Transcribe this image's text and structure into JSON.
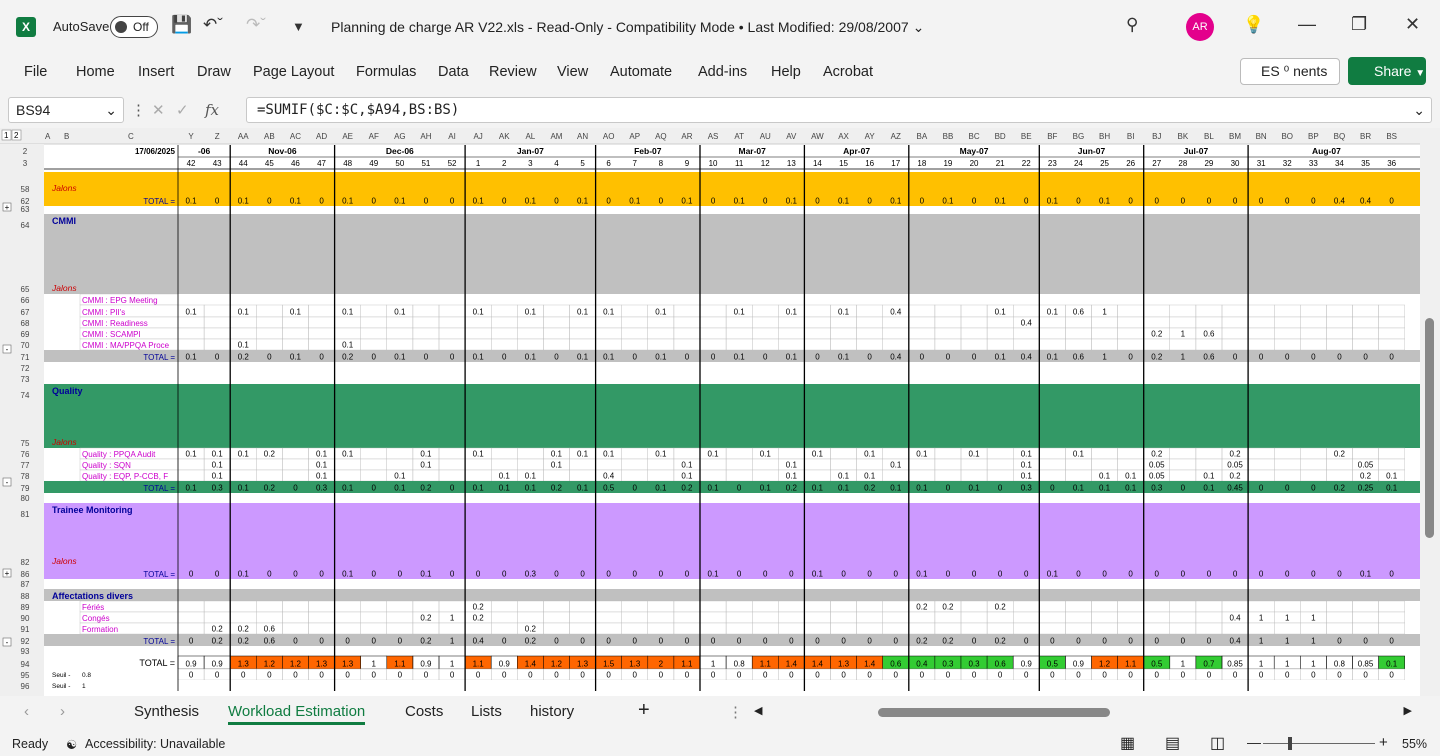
{
  "app": {
    "autosave_label": "AutoSave",
    "autosave_state": "Off",
    "logo": "X"
  },
  "window": {
    "title": "Planning de charge AR V22.xls  -  Read-Only  -  Compatibility Mode  •  Last Modified: 29/08/2007",
    "user_initials": "AR"
  },
  "menu": [
    "File",
    "Home",
    "Insert",
    "Draw",
    "Page Layout",
    "Formulas",
    "Data",
    "Review",
    "View",
    "Automate",
    "Add-ins",
    "Help",
    "Acrobat"
  ],
  "ribbon": {
    "comments_label": "ES  ⁰ nents",
    "share_label": "Share"
  },
  "formula_bar": {
    "name_box": "BS94",
    "formula": "=SUMIF($C:$C,$A94,BS:BS)"
  },
  "sheet": {
    "date_cell": "17/06/2025",
    "columns": [
      "Y",
      "Z",
      "AA",
      "AB",
      "AC",
      "AD",
      "AE",
      "AF",
      "AG",
      "AH",
      "AI",
      "AJ",
      "AK",
      "AL",
      "AM",
      "AN",
      "AO",
      "AP",
      "AQ",
      "AR",
      "AS",
      "AT",
      "AU",
      "AV",
      "AW",
      "AX",
      "AY",
      "AZ",
      "BA",
      "BB",
      "BC",
      "BD",
      "BE",
      "BF",
      "BG",
      "BH",
      "BI",
      "BJ",
      "BK",
      "BL",
      "BM",
      "BN",
      "BO",
      "BP",
      "BQ",
      "BR",
      "BS"
    ],
    "weeks": [
      "42",
      "43",
      "44",
      "45",
      "46",
      "47",
      "48",
      "49",
      "50",
      "51",
      "52",
      "1",
      "2",
      "3",
      "4",
      "5",
      "6",
      "7",
      "8",
      "9",
      "10",
      "11",
      "12",
      "13",
      "14",
      "15",
      "16",
      "17",
      "18",
      "19",
      "20",
      "21",
      "22",
      "23",
      "24",
      "25",
      "26",
      "27",
      "28",
      "29",
      "30",
      "31",
      "32",
      "33",
      "34",
      "35",
      "36"
    ],
    "months": [
      {
        "label": "-06",
        "start": 0,
        "span": 2
      },
      {
        "label": "Nov-06",
        "start": 2,
        "span": 4
      },
      {
        "label": "Dec-06",
        "start": 6,
        "span": 5
      },
      {
        "label": "Jan-07",
        "start": 11,
        "span": 5
      },
      {
        "label": "Feb-07",
        "start": 16,
        "span": 4
      },
      {
        "label": "Mar-07",
        "start": 20,
        "span": 4
      },
      {
        "label": "Apr-07",
        "start": 24,
        "span": 4
      },
      {
        "label": "May-07",
        "start": 28,
        "span": 5
      },
      {
        "label": "Jun-07",
        "start": 33,
        "span": 4
      },
      {
        "label": "Jul-07",
        "start": 37,
        "span": 4
      },
      {
        "label": "Aug-07",
        "start": 41,
        "span": 6
      }
    ],
    "rows": [
      {
        "num": "58",
        "h": 22,
        "bg": "#ffc000",
        "label": "Jalons",
        "label_style": "jalon"
      },
      {
        "num": "62",
        "h": 12,
        "bg": "#ffc000",
        "label": "TOTAL =",
        "label_style": "total",
        "vals": [
          "0.1",
          "0",
          "0.1",
          "0",
          "0.1",
          "0",
          "0.1",
          "0",
          "0.1",
          "0",
          "0",
          "0.1",
          "0",
          "0.1",
          "0",
          "0.1",
          "0",
          "0.1",
          "0",
          "0.1",
          "0",
          "0.1",
          "0",
          "0.1",
          "0",
          "0.1",
          "0",
          "0.1",
          "0",
          "0.1",
          "0",
          "0.1",
          "0",
          "0.1",
          "0",
          "0.1",
          "0",
          "0",
          "0",
          "0",
          "0",
          "0",
          "0",
          "0",
          "0.4",
          "0.4",
          "0"
        ]
      },
      {
        "num": "63",
        "h": 8,
        "bg": "#ffffff"
      },
      {
        "num": "64",
        "h": 16,
        "bg": "#c0c0c0",
        "section": "CMMI"
      },
      {
        "num": "65",
        "h": 64,
        "bg": "#c0c0c0",
        "label": "Jalons",
        "label_style": "jalon"
      },
      {
        "num": "66",
        "h": 11,
        "bg": "#ffffff",
        "sub": "CMMI : EPG Meeting",
        "vals": []
      },
      {
        "num": "67",
        "h": 12,
        "bg": "#ffffff",
        "sub": "CMMI : PII's",
        "vals": [
          "0.1",
          "",
          "0.1",
          "",
          "0.1",
          "",
          "0.1",
          "",
          "0.1",
          "",
          "",
          "0.1",
          "",
          "0.1",
          "",
          "0.1",
          "0.1",
          "",
          "0.1",
          "",
          "",
          "0.1",
          "",
          "0.1",
          "",
          "0.1",
          "",
          "0.4",
          "",
          "",
          "",
          "0.1",
          "",
          "0.1",
          "0.6",
          "1",
          "",
          "",
          "",
          "",
          "",
          "",
          "",
          "",
          "",
          "",
          ""
        ]
      },
      {
        "num": "68",
        "h": 11,
        "bg": "#ffffff",
        "sub": "CMMI : Readiness",
        "vals": [
          "",
          "",
          "",
          "",
          "",
          "",
          "",
          "",
          "",
          "",
          "",
          "",
          "",
          "",
          "",
          "",
          "",
          "",
          "",
          "",
          "",
          "",
          "",
          "",
          "",
          "",
          "",
          "",
          "",
          "",
          "",
          "",
          "0.4",
          "",
          "",
          "",
          "",
          "",
          "",
          "",
          "",
          "",
          "",
          "",
          "",
          "",
          ""
        ]
      },
      {
        "num": "69",
        "h": 11,
        "bg": "#ffffff",
        "sub": "CMMI : SCAMPI",
        "vals": [
          "",
          "",
          "",
          "",
          "",
          "",
          "",
          "",
          "",
          "",
          "",
          "",
          "",
          "",
          "",
          "",
          "",
          "",
          "",
          "",
          "",
          "",
          "",
          "",
          "",
          "",
          "",
          "",
          "",
          "",
          "",
          "",
          "",
          "",
          "",
          "",
          "",
          "0.2",
          "1",
          "0.6",
          "",
          "",
          "",
          "",
          "",
          "",
          ""
        ]
      },
      {
        "num": "70",
        "h": 11,
        "bg": "#ffffff",
        "sub": "CMMI : MA/PPQA Proce",
        "vals": [
          "",
          "",
          "0.1",
          "",
          "",
          "",
          "0.1",
          "",
          "",
          "",
          "",
          "",
          "",
          "",
          "",
          "",
          "",
          "",
          "",
          "",
          "",
          "",
          "",
          "",
          "",
          "",
          "",
          "",
          "",
          "",
          "",
          "",
          "",
          "",
          "",
          "",
          "",
          "",
          "",
          "",
          "",
          "",
          "",
          "",
          "",
          "",
          ""
        ]
      },
      {
        "num": "71",
        "h": 12,
        "bg": "#c0c0c0",
        "label": "TOTAL =",
        "label_style": "total",
        "vals": [
          "0.1",
          "0",
          "0.2",
          "0",
          "0.1",
          "0",
          "0.2",
          "0",
          "0.1",
          "0",
          "0",
          "0.1",
          "0",
          "0.1",
          "0",
          "0.1",
          "0.1",
          "0",
          "0.1",
          "0",
          "0",
          "0.1",
          "0",
          "0.1",
          "0",
          "0.1",
          "0",
          "0.4",
          "0",
          "0",
          "0",
          "0.1",
          "0.4",
          "0.1",
          "0.6",
          "1",
          "0",
          "0.2",
          "1",
          "0.6",
          "0",
          "0",
          "0",
          "0",
          "0",
          "0",
          "0"
        ]
      },
      {
        "num": "72",
        "h": 11,
        "bg": "#ffffff"
      },
      {
        "num": "73",
        "h": 11,
        "bg": "#ffffff"
      },
      {
        "num": "74",
        "h": 16,
        "bg": "#339966",
        "section": "Quality"
      },
      {
        "num": "75",
        "h": 48,
        "bg": "#339966",
        "label": "Jalons",
        "label_style": "jalon"
      },
      {
        "num": "76",
        "h": 11,
        "bg": "#ffffff",
        "sub": "Quality : PPQA Audit",
        "vals": [
          "0.1",
          "0.1",
          "0.1",
          "0.2",
          "",
          "0.1",
          "0.1",
          "",
          "",
          "0.1",
          "",
          "0.1",
          "",
          "",
          "0.1",
          "0.1",
          "0.1",
          "",
          "0.1",
          "",
          "0.1",
          "",
          "0.1",
          "",
          "0.1",
          "",
          "0.1",
          "",
          "0.1",
          "",
          "0.1",
          "",
          "0.1",
          "",
          "0.1",
          "",
          "",
          "0.2",
          "",
          "",
          "0.2",
          "",
          "",
          "",
          "0.2",
          "",
          ""
        ]
      },
      {
        "num": "77",
        "h": 11,
        "bg": "#ffffff",
        "sub": "Quality : SQN",
        "vals": [
          "",
          "0.1",
          "",
          "",
          "",
          "0.1",
          "",
          "",
          "",
          "0.1",
          "",
          "",
          "",
          "",
          "0.1",
          "",
          "",
          "",
          "",
          "0.1",
          "",
          "",
          "",
          "0.1",
          "",
          "",
          "",
          "0.1",
          "",
          "",
          "",
          "",
          "0.1",
          "",
          "",
          "",
          "",
          "0.05",
          "",
          "",
          "0.05",
          "",
          "",
          "",
          "",
          "0.05",
          ""
        ]
      },
      {
        "num": "78",
        "h": 11,
        "bg": "#ffffff",
        "sub": "Quality : EQP, P-CCB, F",
        "vals": [
          "",
          "0.1",
          "",
          "",
          "",
          "0.1",
          "",
          "",
          "0.1",
          "",
          "",
          "",
          "0.1",
          "0.1",
          "",
          "",
          "0.4",
          "",
          "",
          "0.1",
          "",
          "",
          "",
          "0.1",
          "",
          "0.1",
          "0.1",
          "",
          "",
          "",
          "",
          "",
          "0.1",
          "",
          "",
          "0.1",
          "0.1",
          "0.05",
          "",
          "0.1",
          "0.2",
          "",
          "",
          "",
          "",
          "0.2",
          "0.1"
        ]
      },
      {
        "num": "79",
        "h": 12,
        "bg": "#339966",
        "label": "TOTAL =",
        "label_style": "total",
        "vals": [
          "0.1",
          "0.3",
          "0.1",
          "0.2",
          "0",
          "0.3",
          "0.1",
          "0",
          "0.1",
          "0.2",
          "0",
          "0.1",
          "0.1",
          "0.1",
          "0.2",
          "0.1",
          "0.5",
          "0",
          "0.1",
          "0.2",
          "0.1",
          "0",
          "0.1",
          "0.2",
          "0.1",
          "0.1",
          "0.2",
          "0.1",
          "0.1",
          "0",
          "0.1",
          "0",
          "0.3",
          "0",
          "0.1",
          "0.1",
          "0.1",
          "0.3",
          "0",
          "0.1",
          "0.45",
          "0",
          "0",
          "0",
          "0.2",
          "0.25",
          "0.1"
        ]
      },
      {
        "num": "80",
        "h": 10,
        "bg": "#ffffff"
      },
      {
        "num": "81",
        "h": 16,
        "bg": "#cc99ff",
        "section": "Trainee Monitoring"
      },
      {
        "num": "82",
        "h": 48,
        "bg": "#cc99ff",
        "label": "Jalons",
        "label_style": "jalon"
      },
      {
        "num": "86",
        "h": 12,
        "bg": "#cc99ff",
        "label": "TOTAL =",
        "label_style": "total",
        "vals": [
          "0",
          "0",
          "0.1",
          "0",
          "0",
          "0",
          "0.1",
          "0",
          "0",
          "0.1",
          "0",
          "0",
          "0",
          "0.3",
          "0",
          "0",
          "0",
          "0",
          "0",
          "0",
          "0.1",
          "0",
          "0",
          "0",
          "0.1",
          "0",
          "0",
          "0",
          "0.1",
          "0",
          "0",
          "0",
          "0",
          "0.1",
          "0",
          "0",
          "0",
          "0",
          "0",
          "0",
          "0",
          "0",
          "0",
          "0",
          "0",
          "0.1",
          "0"
        ]
      },
      {
        "num": "87",
        "h": 10,
        "bg": "#ffffff"
      },
      {
        "num": "88",
        "h": 12,
        "bg": "#c0c0c0",
        "section": "Affectations divers"
      },
      {
        "num": "89",
        "h": 11,
        "bg": "#ffffff",
        "sub": "Fériés",
        "vals": [
          "",
          "",
          "",
          "",
          "",
          "",
          "",
          "",
          "",
          "",
          "",
          "0.2",
          "",
          "",
          "",
          "",
          "",
          "",
          "",
          "",
          "",
          "",
          "",
          "",
          "",
          "",
          "",
          "",
          "0.2",
          "0.2",
          "",
          "0.2",
          "",
          "",
          "",
          "",
          "",
          "",
          "",
          "",
          "",
          "",
          "",
          "",
          "",
          "",
          ""
        ]
      },
      {
        "num": "90",
        "h": 11,
        "bg": "#ffffff",
        "sub": "Congés",
        "vals": [
          "",
          "",
          "",
          "",
          "",
          "",
          "",
          "",
          "",
          "0.2",
          "1",
          "0.2",
          "",
          "",
          "",
          "",
          "",
          "",
          "",
          "",
          "",
          "",
          "",
          "",
          "",
          "",
          "",
          "",
          "",
          "",
          "",
          "",
          "",
          "",
          "",
          "",
          "",
          "",
          "",
          "",
          "0.4",
          "1",
          "1",
          "1",
          "",
          "",
          ""
        ]
      },
      {
        "num": "91",
        "h": 11,
        "bg": "#ffffff",
        "sub": "Formation",
        "vals": [
          "",
          "0.2",
          "0.2",
          "0.6",
          "",
          "",
          "",
          "",
          "",
          "",
          "",
          "",
          "",
          "0.2",
          "",
          "",
          "",
          "",
          "",
          "",
          "",
          "",
          "",
          "",
          "",
          "",
          "",
          "",
          "",
          "",
          "",
          "",
          "",
          "",
          "",
          "",
          "",
          "",
          "",
          "",
          "",
          "",
          "",
          "",
          "",
          "",
          ""
        ]
      },
      {
        "num": "92",
        "h": 12,
        "bg": "#c0c0c0",
        "label": "TOTAL =",
        "label_style": "total",
        "vals": [
          "0",
          "0.2",
          "0.2",
          "0.6",
          "0",
          "0",
          "0",
          "0",
          "0",
          "0.2",
          "1",
          "0.4",
          "0",
          "0.2",
          "0",
          "0",
          "0",
          "0",
          "0",
          "0",
          "0",
          "0",
          "0",
          "0",
          "0",
          "0",
          "0",
          "0",
          "0.2",
          "0.2",
          "0",
          "0.2",
          "0",
          "0",
          "0",
          "0",
          "0",
          "0",
          "0",
          "0",
          "0.4",
          "1",
          "1",
          "1",
          "0",
          "0",
          "0"
        ]
      },
      {
        "num": "93",
        "h": 10,
        "bg": "#ffffff"
      },
      {
        "num": "94",
        "h": 13,
        "bg": "#ffffff",
        "label": "TOTAL =",
        "label_style": "grand",
        "vals": [
          "0.9",
          "0.9",
          "1.3",
          "1.2",
          "1.2",
          "1.3",
          "1.3",
          "1",
          "1.1",
          "0.9",
          "1",
          "1.1",
          "0.9",
          "1.4",
          "1.2",
          "1.3",
          "1.5",
          "1.3",
          "2",
          "1.1",
          "1",
          "0.8",
          "1.1",
          "1.4",
          "1.4",
          "1.3",
          "1.4",
          "0.6",
          "0.4",
          "0.3",
          "0.3",
          "0.6",
          "0.9",
          "0.5",
          "0.9",
          "1.2",
          "1.1",
          "0.5",
          "1",
          "0.7",
          "0.85",
          "1",
          "1",
          "1",
          "0.8",
          "0.85",
          "0.1"
        ]
      },
      {
        "num": "95",
        "h": 11,
        "bg": "#ffffff",
        "seuil": "Seuil -",
        "seuil_val": "0.8",
        "vals": [
          "0",
          "0",
          "0",
          "0",
          "0",
          "0",
          "0",
          "0",
          "0",
          "0",
          "0",
          "0",
          "0",
          "0",
          "0",
          "0",
          "0",
          "0",
          "0",
          "0",
          "0",
          "0",
          "0",
          "0",
          "0",
          "0",
          "0",
          "0",
          "0",
          "0",
          "0",
          "0",
          "0",
          "0",
          "0",
          "0",
          "0",
          "0",
          "0",
          "0",
          "0",
          "0",
          "0",
          "0",
          "0",
          "0",
          "0"
        ]
      },
      {
        "num": "96",
        "h": 11,
        "bg": "#ffffff",
        "seuil": "Seuil -",
        "seuil_val": "1"
      }
    ]
  },
  "tabs": [
    "Synthesis",
    "Workload Estimation",
    "Costs",
    "Lists",
    "history"
  ],
  "active_tab": "Workload Estimation",
  "status": {
    "ready": "Ready",
    "accessibility": "Accessibility: Unavailable",
    "zoom": "55%"
  },
  "colors": {
    "excel_green": "#107c41",
    "over": "#ff6600",
    "under": "#33cc33",
    "yellow_band": "#ffc000",
    "cmmi_band": "#c0c0c0",
    "quality_band": "#339966",
    "trainee_band": "#cc99ff",
    "section_text": "#000099",
    "sub_text": "#cc00cc",
    "jalon_text": "#cc0000"
  }
}
